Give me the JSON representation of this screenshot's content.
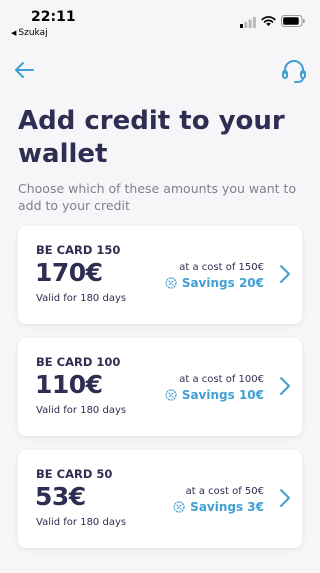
{
  "status_bar": {
    "time": "22:11",
    "back_label": "Szukaj"
  },
  "header": {
    "back_icon": "arrow-left-icon",
    "support_icon": "headset-icon",
    "accent_color": "#3f9fd3"
  },
  "page": {
    "title": "Add credit to your wallet",
    "subtitle": "Choose which of these amounts you want to add to your credit"
  },
  "cards": [
    {
      "name": "BE CARD 150",
      "amount": "170€",
      "validity": "Valid for 180 days",
      "cost": "at a cost of 150€",
      "savings": "Savings 20€"
    },
    {
      "name": "BE CARD 100",
      "amount": "110€",
      "validity": "Valid for 180 days",
      "cost": "at a cost of 100€",
      "savings": "Savings 10€"
    },
    {
      "name": "BE CARD 50",
      "amount": "53€",
      "validity": "Valid for 180 days",
      "cost": "at a cost of 50€",
      "savings": "Savings 3€"
    }
  ]
}
